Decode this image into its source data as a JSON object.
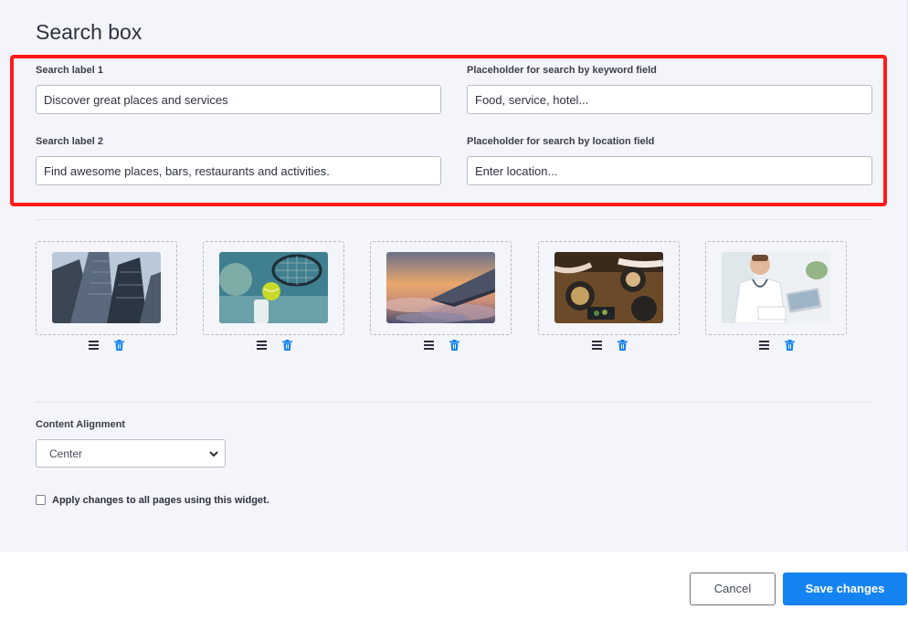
{
  "section_title": "Search box",
  "fields": {
    "search_label_1": {
      "label": "Search label 1",
      "value": "Discover great places and services"
    },
    "keyword_placeholder": {
      "label": "Placeholder for search by keyword field",
      "value": "Food, service, hotel..."
    },
    "search_label_2": {
      "label": "Search label 2",
      "value": "Find awesome places, bars, restaurants and activities."
    },
    "location_placeholder": {
      "label": "Placeholder for search by location field",
      "value": "Enter location..."
    }
  },
  "images": [
    {
      "subject": "skyscrapers"
    },
    {
      "subject": "tennis ball and racket"
    },
    {
      "subject": "airplane wing above clouds at sunset"
    },
    {
      "subject": "restaurant dinner table"
    },
    {
      "subject": "doctor at laptop"
    }
  ],
  "image_actions": {
    "reorder_icon": "menu-icon",
    "delete_icon": "trash-icon",
    "delete_color": "#1583f2"
  },
  "content_alignment": {
    "label": "Content Alignment",
    "selected": "Center"
  },
  "apply_all": {
    "label": "Apply changes to all pages using this widget.",
    "checked": false
  },
  "buttons": {
    "cancel": "Cancel",
    "save": "Save changes"
  },
  "colors": {
    "accent": "#1583f2",
    "highlight": "#ff1a1a",
    "panel_bg": "#f4f5fa"
  }
}
